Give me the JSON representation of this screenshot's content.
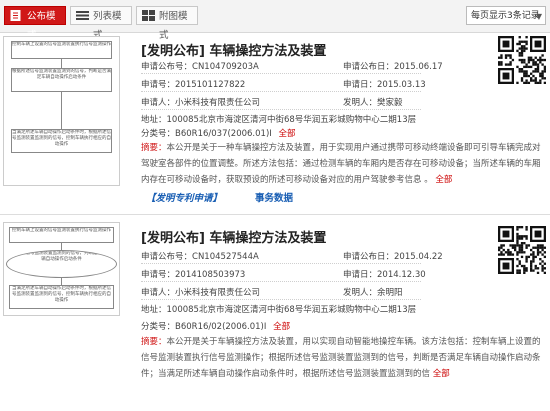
{
  "toolbar": {
    "tabs": [
      {
        "label": "公布模式",
        "active": true
      },
      {
        "label": "列表模式",
        "active": false
      },
      {
        "label": "附图模式",
        "active": false
      }
    ],
    "per_page": "每页显示3条记录"
  },
  "labels": {
    "pub_no": "申请公布号：",
    "pub_date": "申请公布日：",
    "app_no": "申请号：",
    "app_date": "申请日：",
    "applicant": "申请人：",
    "inventor": "发明人：",
    "address": "地址：",
    "classification": "分类号：",
    "all": "全部",
    "abstract": "摘要：",
    "app_link": "【发明专利申请】",
    "data_link": "事务数据"
  },
  "records": [
    {
      "title": "[发明公布] 车辆操控方法及装置",
      "pub_no": "CN104709203A",
      "pub_date": "2015.06.17",
      "app_no": "2015101127822",
      "app_date": "2015.03.13",
      "applicant": "小米科技有限责任公司",
      "inventor": "樊家毅",
      "address": "100085北京市海淀区清河中街68号华润五彩城购物中心二期13层",
      "classification": "B60R16/037(2006.01)I",
      "abstract": "本公开是关于一种车辆操控方法及装置，用于实现用户通过携带可移动终端设备即可引导车辆完成对驾驶室各部件的位置调整。所述方法包括：通过检测车辆的车厢内是否存在可移动设备；当所述车辆的车厢内存在可移动设备时，获取预设的所述可移动设备对应的用户驾驶参考信息 。",
      "abstract_all": "全部"
    },
    {
      "title": "[发明公布] 车辆操控方法及装置",
      "pub_no": "CN104527544A",
      "pub_date": "2015.04.22",
      "app_no": "2014108503973",
      "app_date": "2014.12.30",
      "applicant": "小米科技有限责任公司",
      "inventor": "余明阳",
      "address": "100085北京市海淀区清河中街68号华润五彩城购物中心二期13层",
      "classification": "B60R16/02(2006.01)I",
      "abstract": "本公开是关于车辆操控方法及装置，用以实现自动智能地操控车辆。该方法包括：控制车辆上设置的信号监测装置执行信号监测操作；根据所述信号监测装置监测到的信号，判断是否满足车辆自动操作启动条件；当满足所述车辆自动操作启动条件时，根据所述信号监测装置监测到的信",
      "abstract_all": "全部"
    }
  ],
  "thumb1_boxes": [
    "控制车辆上设置的信号监测装置执行信号监测操作",
    "根据所述信号监测装置监测到的信号，判断是否满足车辆自动操作启动条件",
    "当满足所述车辆自动操作启动条件时，根据所述信号监测装置监测到的信号，控制车辆执行相应的自动操作"
  ],
  "thumb2_boxes": [
    "控制车辆上设置的信号监测装置执行信号监测操作",
    "根据所述信号监测装置监测到的信号，判断是否满足车辆自动操作启动条件",
    "当满足所述车辆自动操作启动条件时，根据所述信号监测装置监测到的信号，控制车辆执行相应的自动操作"
  ],
  "colors": {
    "accent": "#d01818",
    "link": "#1a5fb4"
  }
}
